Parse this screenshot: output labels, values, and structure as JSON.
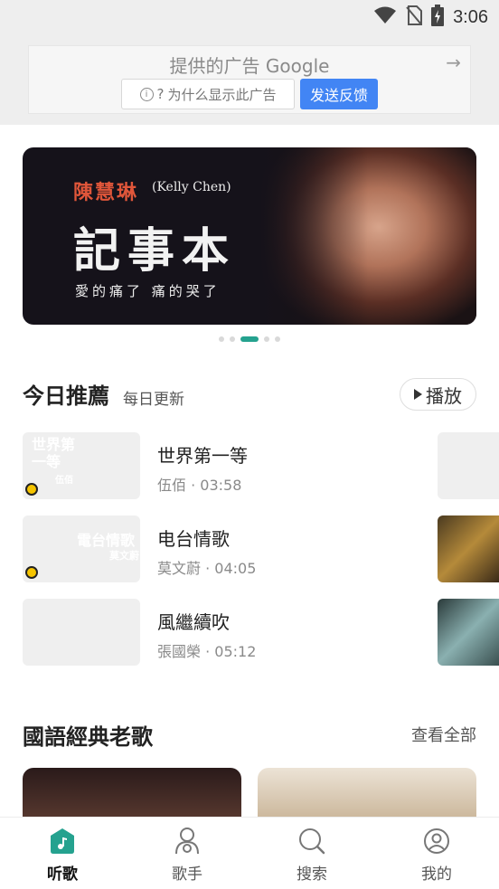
{
  "status_bar": {
    "time": "3:06",
    "icons": [
      "wifi-icon",
      "no-sim-icon",
      "battery-charging-icon"
    ]
  },
  "ad": {
    "title": "提供的广告 Google",
    "why_label": "为什么显示此广告",
    "feedback_label": "发送反馈",
    "info_symbol": "i",
    "question_symbol": "?",
    "arrow_symbol": "→"
  },
  "banner": {
    "artist": "陳慧琳",
    "artist_en": "(Kelly Chen)",
    "album": "記事本",
    "lyric": "愛的痛了 痛的哭了",
    "slide_count": 5,
    "active_slide": 3
  },
  "daily": {
    "title": "今日推薦",
    "subtitle": "每日更新",
    "play_label": "播放",
    "songs": [
      {
        "name": "世界第一等",
        "meta": "伍佰 · 03:58",
        "cover_text": "世界第一等",
        "cover_sub": "伍佰"
      },
      {
        "name": "电台情歌",
        "meta": "莫文蔚 · 04:05",
        "cover_text": "電台情歌",
        "cover_sub": "莫文蔚"
      },
      {
        "name": "風繼續吹",
        "meta": "張國榮 · 05:12",
        "cover_text": "",
        "cover_sub": ""
      }
    ]
  },
  "classics": {
    "title": "國語經典老歌",
    "see_all": "查看全部"
  },
  "bottom_nav": {
    "items": [
      {
        "label": "听歌",
        "icon": "music-note-icon",
        "active": true
      },
      {
        "label": "歌手",
        "icon": "singer-icon",
        "active": false
      },
      {
        "label": "搜索",
        "icon": "search-icon",
        "active": false
      },
      {
        "label": "我的",
        "icon": "profile-icon",
        "active": false
      }
    ]
  },
  "colors": {
    "accent": "#25a28f",
    "ad_button": "#4285f4",
    "artist_red": "#e0563a"
  }
}
